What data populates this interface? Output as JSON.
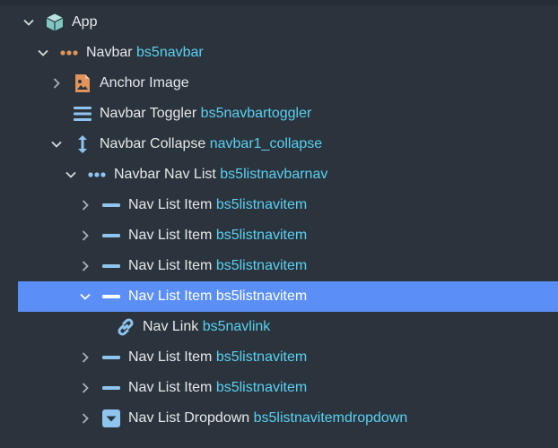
{
  "tree": {
    "items": [
      {
        "name": "App",
        "id": "",
        "depth": 0,
        "expanded": true,
        "has_children": true,
        "icon": "cube-icon"
      },
      {
        "name": "Navbar",
        "id": "bs5navbar",
        "depth": 1,
        "expanded": true,
        "has_children": true,
        "icon": "dots-icon"
      },
      {
        "name": "Anchor Image",
        "id": "",
        "depth": 2,
        "expanded": false,
        "has_children": true,
        "icon": "image-file-icon"
      },
      {
        "name": "Navbar Toggler",
        "id": "bs5navbartoggler",
        "depth": 2,
        "expanded": false,
        "has_children": false,
        "icon": "hamburger-icon"
      },
      {
        "name": "Navbar Collapse",
        "id": "navbar1_collapse",
        "depth": 2,
        "expanded": true,
        "has_children": true,
        "icon": "vertical-arrows-icon"
      },
      {
        "name": "Navbar Nav List",
        "id": "bs5listnavbarnav",
        "depth": 3,
        "expanded": true,
        "has_children": true,
        "icon": "dots-icon"
      },
      {
        "name": "Nav List Item",
        "id": "bs5listnavitem",
        "depth": 4,
        "expanded": false,
        "has_children": true,
        "icon": "dash-icon"
      },
      {
        "name": "Nav List Item",
        "id": "bs5listnavitem",
        "depth": 4,
        "expanded": false,
        "has_children": true,
        "icon": "dash-icon"
      },
      {
        "name": "Nav List Item",
        "id": "bs5listnavitem",
        "depth": 4,
        "expanded": false,
        "has_children": true,
        "icon": "dash-icon"
      },
      {
        "name": "Nav List Item",
        "id": "bs5listnavitem",
        "depth": 4,
        "expanded": true,
        "has_children": true,
        "icon": "dash-icon",
        "selected": true
      },
      {
        "name": "Nav Link",
        "id": "bs5navlink",
        "depth": 5,
        "expanded": false,
        "has_children": false,
        "icon": "link-icon"
      },
      {
        "name": "Nav List Item",
        "id": "bs5listnavitem",
        "depth": 4,
        "expanded": false,
        "has_children": true,
        "icon": "dash-icon"
      },
      {
        "name": "Nav List Item",
        "id": "bs5listnavitem",
        "depth": 4,
        "expanded": false,
        "has_children": true,
        "icon": "dash-icon"
      },
      {
        "name": "Nav List Dropdown",
        "id": "bs5listnavitemdropdown",
        "depth": 4,
        "expanded": false,
        "has_children": true,
        "icon": "dropdown-icon"
      }
    ]
  },
  "colors": {
    "background": "#2b343c",
    "selection": "#5b8ff7",
    "text": "#e6e8ea",
    "identifier": "#5ad0f2",
    "cube": "#7fc7c0",
    "orange": "#e0935a",
    "blue_icon": "#8fc4ef"
  }
}
